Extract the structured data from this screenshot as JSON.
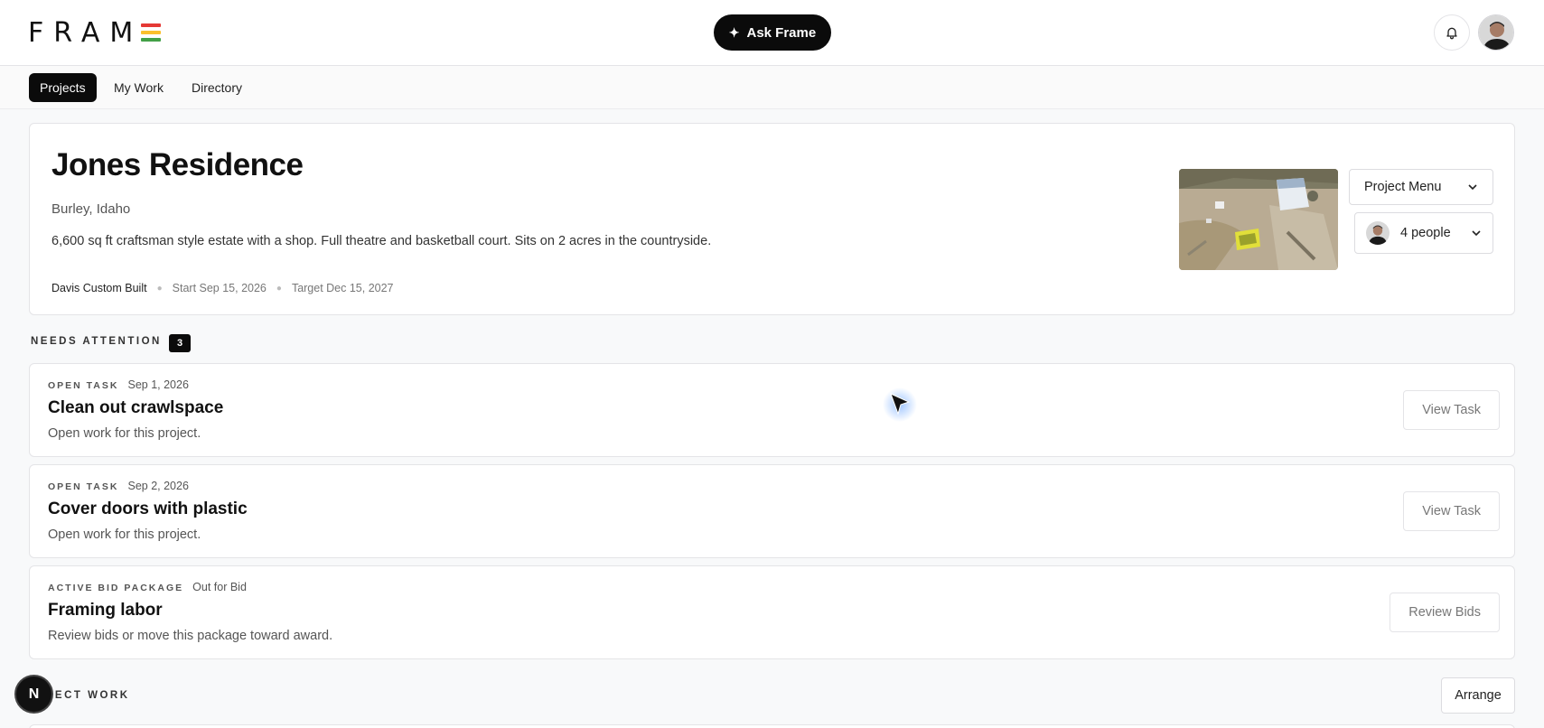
{
  "header": {
    "logo_text": "FRAM",
    "logo_bar_colors": [
      "#e53935",
      "#fbc02d",
      "#43a047"
    ],
    "ask_label": "Ask Frame",
    "ask_icon": "sparkle-icon",
    "notification_icon": "bell-icon"
  },
  "nav": {
    "tabs": [
      {
        "label": "Projects",
        "active": true
      },
      {
        "label": "My Work",
        "active": false
      },
      {
        "label": "Directory",
        "active": false
      }
    ]
  },
  "project": {
    "title": "Jones Residence",
    "location": "Burley, Idaho",
    "description": "6,600 sq ft craftsman style estate with a shop. Full theatre and basketball court. Sits on 2 acres in the countryside.",
    "builder": "Davis Custom Built",
    "start": "Start Sep 15, 2026",
    "target": "Target Dec 15, 2027",
    "menu_label": "Project Menu",
    "people_label": "4 people"
  },
  "needs_attention": {
    "label": "NEEDS ATTENTION",
    "count": "3",
    "items": [
      {
        "type": "OPEN TASK",
        "meta": "Sep 1, 2026",
        "title": "Clean out crawlspace",
        "subtitle": "Open work for this project.",
        "action": "View Task"
      },
      {
        "type": "OPEN TASK",
        "meta": "Sep 2, 2026",
        "title": "Cover doors with plastic",
        "subtitle": "Open work for this project.",
        "action": "View Task"
      },
      {
        "type": "ACTIVE BID PACKAGE",
        "meta": "Out for Bid",
        "title": "Framing labor",
        "subtitle": "Review bids or move this package toward award.",
        "action": "Review Bids"
      }
    ]
  },
  "project_work": {
    "label_visible": "JECT WORK",
    "arrange_label": "Arrange"
  },
  "dev_badge": {
    "label": "N"
  },
  "colors": {
    "primary": "#0b0b0b",
    "border": "#e4e4e7",
    "muted_text": "#555555"
  }
}
